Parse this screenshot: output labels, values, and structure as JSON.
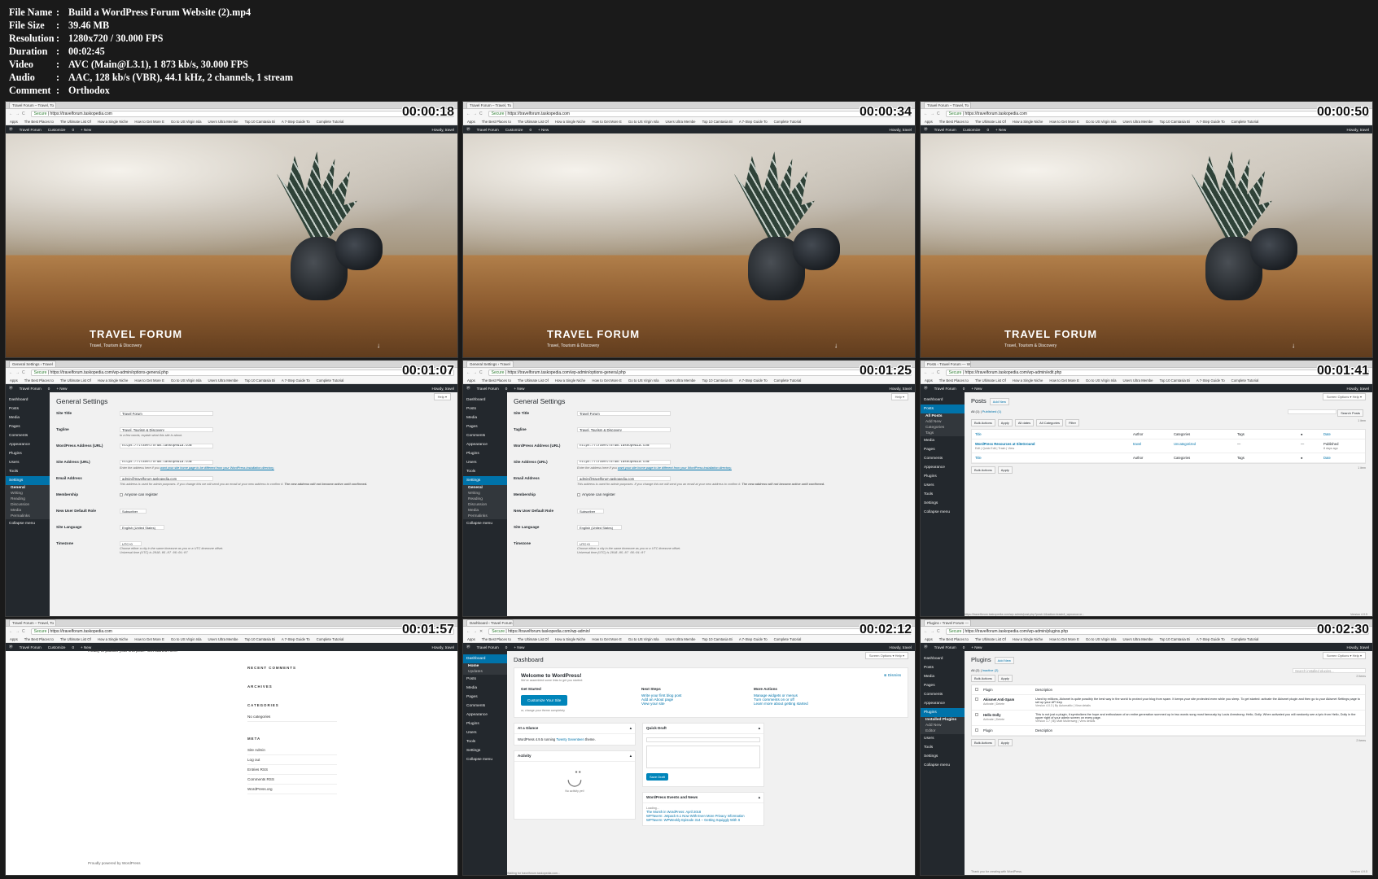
{
  "meta": [
    {
      "key": "File Name",
      "value": "Build a WordPress Forum Website (2).mp4"
    },
    {
      "key": "File Size",
      "value": "39.46 MB"
    },
    {
      "key": "Resolution",
      "value": "1280x720 / 30.000 FPS"
    },
    {
      "key": "Duration",
      "value": "00:02:45"
    },
    {
      "key": "Video",
      "value": "AVC (Main@L3.1), 1 873 kb/s, 30.000 FPS"
    },
    {
      "key": "Audio",
      "value": "AAC, 128 kb/s (VBR), 44.1 kHz, 2 channels, 1 stream"
    },
    {
      "key": "Comment",
      "value": "Orthodox"
    }
  ],
  "separator": ":",
  "timestamps": [
    "00:00:18",
    "00:00:34",
    "00:00:50",
    "00:01:07",
    "00:01:25",
    "00:01:41",
    "00:01:57",
    "00:02:12",
    "00:02:30"
  ],
  "browser": {
    "tabs": {
      "front": "Travel Forum – Travel, To",
      "settings": "General Settings ‹ Travel",
      "posts": "Posts ‹ Travel Forum — W",
      "dash": "Dashboard ‹ Travel Forum",
      "plugins": "Plugins ‹ Travel Forum —"
    },
    "secure": "Secure",
    "urls": {
      "front": "https://travelforum.taskopedia.com",
      "settings": "https://travelforum.taskopedia.com/wp-admin/options-general.php",
      "posts": "https://travelforum.taskopedia.com/wp-admin/edit.php",
      "dash": "https://travelforum.taskopedia.com/wp-admin/",
      "plugins": "https://travelforum.taskopedia.com/wp-admin/plugins.php"
    },
    "bookmarks": [
      "Apps",
      "The Best Places to",
      "The Ultimate List Of",
      "How a Single Niche",
      "How to Get More E",
      "Go to US Virgin Isla",
      "Users Ultra Membe",
      "Top 10 Camtasia Bi",
      "A 7-Step Guide To",
      "Complete Tutorial"
    ]
  },
  "adminbar": {
    "site": "Travel Forum",
    "customize": "Customize",
    "comments": "0",
    "new": "+ New",
    "howdy": "Howdy, travel"
  },
  "hero": {
    "title": "TRAVEL FORUM",
    "tagline": "Travel, Tourism & Discovery",
    "arrow": "↓"
  },
  "menu": {
    "dashboard": "Dashboard",
    "home": "Home",
    "updates": "Updates",
    "posts": "Posts",
    "all_posts": "All Posts",
    "add_new": "Add New",
    "categories": "Categories",
    "tags": "Tags",
    "media": "Media",
    "pages": "Pages",
    "comments": "Comments",
    "appearance": "Appearance",
    "plugins": "Plugins",
    "installed_plugins": "Installed Plugins",
    "editor": "Editor",
    "users": "Users",
    "tools": "Tools",
    "settings": "Settings",
    "general": "General",
    "writing": "Writing",
    "reading": "Reading",
    "discussion": "Discussion",
    "media_sub": "Media",
    "permalinks": "Permalinks",
    "collapse": "Collapse menu"
  },
  "settings": {
    "title": "General Settings",
    "help": "Help ▾",
    "site_title_label": "Site Title",
    "site_title": "Travel Forum",
    "tagline_label": "Tagline",
    "tagline": "Travel, Tourism & Discovery",
    "tagline_desc": "In a few words, explain what this site is about.",
    "wp_url_label": "WordPress Address (URL)",
    "wp_url": "https://travelforum.taskopedia.com",
    "site_url_label": "Site Address (URL)",
    "site_url": "https://travelforum.taskopedia.com",
    "site_url_desc": "Enter the address here if you",
    "site_url_link": "want your site home page to be different from your WordPress installation directory.",
    "email_label": "Email Address",
    "email": "admin@travelforum.taskopedia.com",
    "email_desc": "This address is used for admin purposes. If you change this we will send you an email at your new address to confirm it.",
    "email_desc_b": "The new address will not become active until confirmed.",
    "membership_label": "Membership",
    "membership": "Anyone can register",
    "role_label": "New User Default Role",
    "role": "Subscriber",
    "lang_label": "Site Language",
    "lang": "English (United States)",
    "tz_label": "Timezone",
    "tz": "UTC+0",
    "tz_desc": "Choose either a city in the same timezone as you or a UTC timezone offset.",
    "utc_label": "Universal time (UTC) is",
    "utc": "2018-05-07 06:01:07",
    "utc2": "2018-05-07 06:01:07"
  },
  "posts": {
    "title": "Posts",
    "add_new": "Add New",
    "filter_all": "All (1)",
    "filter_pub": "Published (1)",
    "bulk": "Bulk Actions",
    "apply": "Apply",
    "dates": "All dates",
    "cats": "All Categories",
    "filter": "Filter",
    "screen_options": "Screen Options ▾",
    "help": "Help ▾",
    "search": "Search Posts",
    "items": "1 item",
    "cols": {
      "title": "Title",
      "author": "Author",
      "categories": "Categories",
      "tags": "Tags",
      "date": "Date"
    },
    "row": {
      "title": "WordPress Resources at SiteGround",
      "actions": "Edit | Quick Edit | Trash | View",
      "author": "travel",
      "category": "Uncategorized",
      "tags": "—",
      "comments": "—",
      "status": "Published",
      "ago": "8 days ago"
    },
    "footer_url": "https://travelforum.taskopedia.com/wp-admin/post.php?post=1&action=trash&_wpnonce=e...",
    "version": "Version 4.9.5"
  },
  "widgets": {
    "top": "Ready to publish your first post? Get started here.",
    "recent_comments": "RECENT COMMENTS",
    "archives": "ARCHIVES",
    "categories": "CATEGORIES",
    "no_cat": "No categories",
    "meta": "META",
    "meta_items": [
      "Site Admin",
      "Log out",
      "Entries RSS",
      "Comments RSS",
      "WordPress.org"
    ],
    "footer": "Proudly powered by WordPress"
  },
  "dashboard": {
    "title": "Dashboard",
    "screen_options": "Screen Options ▾",
    "help": "Help ▾",
    "welcome": "Welcome to WordPress!",
    "welcome_sub": "We've assembled some links to get you started:",
    "dismiss": "⊗ Dismiss",
    "get_started": "Get Started",
    "customize_btn": "Customize Your Site",
    "change_theme": "or, change your theme completely",
    "next_steps": "Next Steps",
    "next_items": [
      "Write your first blog post",
      "Add an About page",
      "View your site"
    ],
    "more_actions": "More Actions",
    "more_items": [
      "Manage widgets or menus",
      "Turn comments on or off",
      "Learn more about getting started"
    ],
    "glance": "At a Glance",
    "glance_text": "WordPress 4.9.5 running",
    "theme": "Twenty Seventeen",
    "theme_suffix": "theme.",
    "activity": "Activity",
    "no_activity": "No activity yet!",
    "quick_draft": "Quick Draft",
    "save_draft": "Save Draft",
    "events": "WordPress Events and News",
    "loading": "Loading...",
    "news": [
      "The Month in WordPress: April 2018",
      "WPTavern: Jetpack 6.1 Now With Even More Privacy Information",
      "WPTavern: WPWeekly Episode 314 – Getting Squiggly With It"
    ],
    "status": "Waiting for travelforum.taskopedia.com..."
  },
  "plugins": {
    "title": "Plugins",
    "add_new": "Add New",
    "filter_all": "All (2)",
    "filter_inactive": "Inactive (2)",
    "bulk": "Bulk Actions",
    "apply": "Apply",
    "search": "Search installed plugins...",
    "items": "2 items",
    "col_plugin": "Plugin",
    "col_desc": "Description",
    "list": [
      {
        "name": "Akismet Anti-Spam",
        "actions": "Activate | Delete",
        "desc": "Used by millions, Akismet is quite possibly the best way in the world to protect your blog from spam. It keeps your site protected even while you sleep. To get started: activate the Akismet plugin and then go to your Akismet Settings page to set up your API key.",
        "version": "Version 4.0.3 | By Automattic | View details"
      },
      {
        "name": "Hello Dolly",
        "actions": "Activate | Delete",
        "desc": "This is not just a plugin, it symbolizes the hope and enthusiasm of an entire generation summed up in two words sung most famously by Louis Armstrong: Hello, Dolly. When activated you will randomly see a lyric from Hello, Dolly in the upper right of your admin screen on every page.",
        "version": "Version 1.7 | By Matt Mullenweg | View details"
      }
    ],
    "footer": "Thank you for creating with WordPress.",
    "version": "Version 4.9.5",
    "screen_options": "Screen Options ▾",
    "help": "Help ▾"
  }
}
